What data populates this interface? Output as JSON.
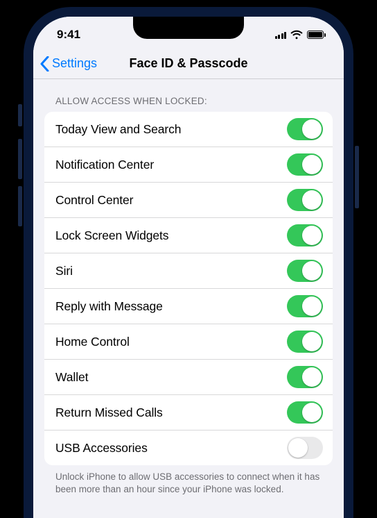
{
  "status": {
    "time": "9:41"
  },
  "nav": {
    "back_label": "Settings",
    "title": "Face ID & Passcode"
  },
  "section": {
    "header": "ALLOW ACCESS WHEN LOCKED:",
    "items": [
      {
        "label": "Today View and Search",
        "on": true
      },
      {
        "label": "Notification Center",
        "on": true
      },
      {
        "label": "Control Center",
        "on": true
      },
      {
        "label": "Lock Screen Widgets",
        "on": true
      },
      {
        "label": "Siri",
        "on": true
      },
      {
        "label": "Reply with Message",
        "on": true
      },
      {
        "label": "Home Control",
        "on": true
      },
      {
        "label": "Wallet",
        "on": true
      },
      {
        "label": "Return Missed Calls",
        "on": true
      },
      {
        "label": "USB Accessories",
        "on": false
      }
    ],
    "footer": "Unlock iPhone to allow USB accessories to connect when it has been more than an hour since your iPhone was locked."
  }
}
